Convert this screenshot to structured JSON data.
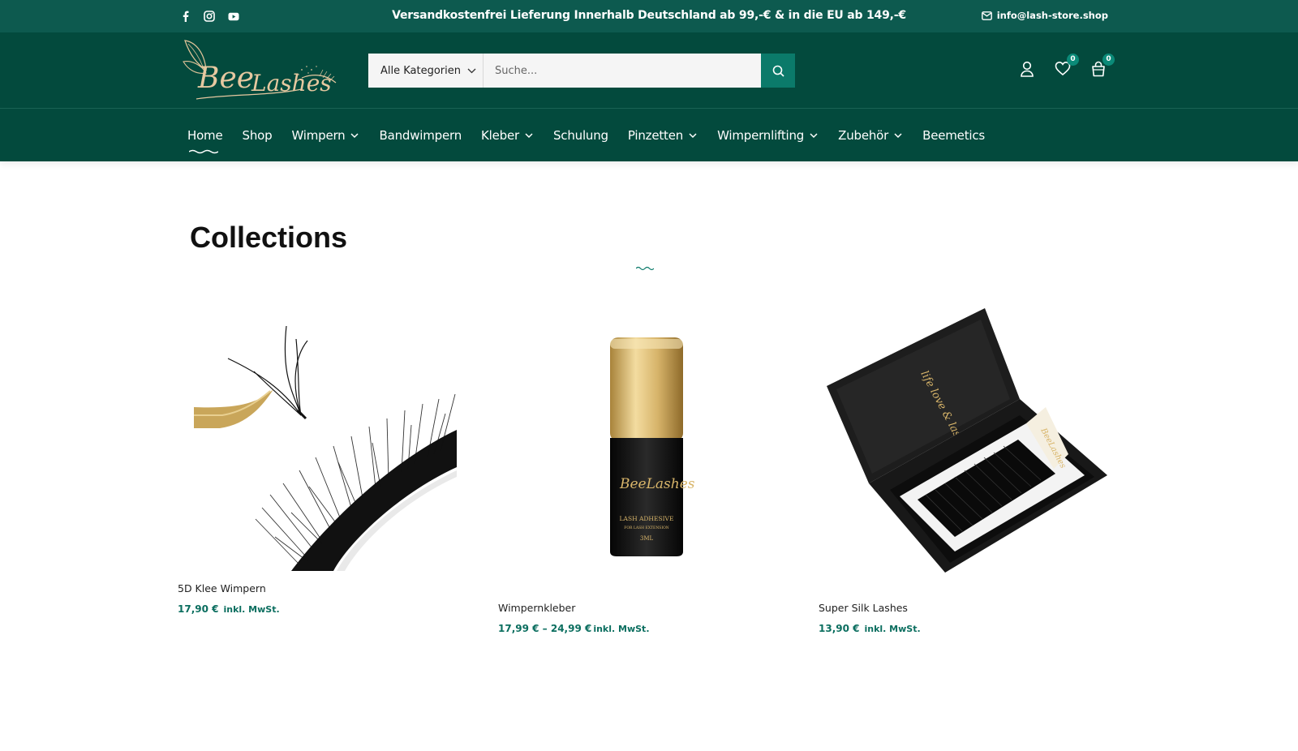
{
  "topbar": {
    "promo": "Versandkostenfrei Lieferung Innerhalb Deutschland ab 99,-€ & in die EU ab 149,-€",
    "email": "info@lash-store.shop",
    "social": [
      "facebook-icon",
      "instagram-icon",
      "youtube-icon"
    ]
  },
  "header": {
    "logo_text": "BeeLashes",
    "search": {
      "category": "Alle Kategorien",
      "placeholder": "Suche..."
    },
    "wishlist_count": "0",
    "cart_count": "0"
  },
  "nav": {
    "items": [
      {
        "label": "Home"
      },
      {
        "label": "Shop"
      },
      {
        "label": "Wimpern"
      },
      {
        "label": "Bandwimpern"
      },
      {
        "label": "Kleber"
      },
      {
        "label": "Schulung"
      },
      {
        "label": "Pinzetten"
      },
      {
        "label": "Wimpernlifting"
      },
      {
        "label": "Zubehör"
      },
      {
        "label": "Beemetics"
      }
    ]
  },
  "main": {
    "title": "Collections",
    "products": [
      {
        "name": "5D Klee Wimpern",
        "price": "17,90 €",
        "tax": "inkl. MwSt."
      },
      {
        "name": "Wimpernkleber",
        "price": "17,99 €  –  24,99 €",
        "tax": "inkl. MwSt."
      },
      {
        "name": "Super Silk Lashes",
        "price": "13,90 €",
        "tax": "inkl. MwSt."
      }
    ]
  },
  "colors": {
    "topbar": "#0d5a4f",
    "header": "#034a3d",
    "accent": "#0b7a6a",
    "price": "#0b6e5f"
  }
}
